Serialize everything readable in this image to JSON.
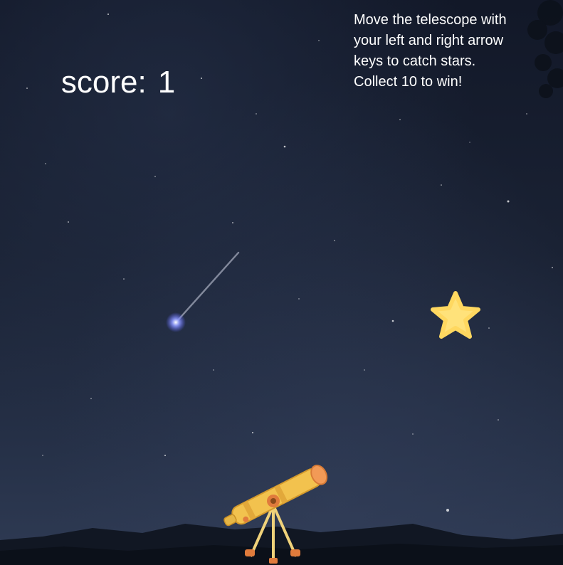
{
  "hud": {
    "score_label": "score:",
    "score_value": "1"
  },
  "instructions": {
    "text": "Move the telescope with\nyour left and right arrow\n keys to catch stars.\nCollect 10 to win!"
  },
  "sprites": {
    "falling_star": "star-icon",
    "player": "telescope-icon",
    "meteor": "shooting-star-icon"
  },
  "colors": {
    "sky_top": "#121828",
    "sky_bottom": "#2f3b54",
    "star_fill": "#ffe27a",
    "telescope_body": "#f2c24e",
    "tripod": "#f0d27a",
    "feet": "#e07b3c",
    "text": "#ffffff"
  }
}
